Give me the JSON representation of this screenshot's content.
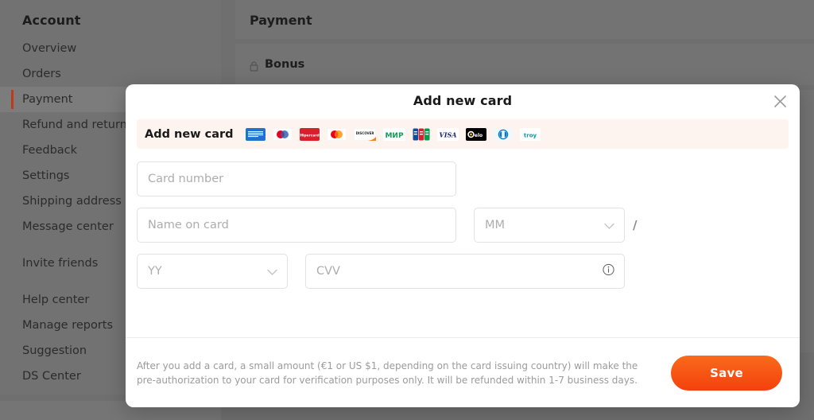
{
  "page": {
    "sidebar": {
      "title": "Account",
      "groups": [
        {
          "items": [
            {
              "label": "Overview",
              "active": false
            },
            {
              "label": "Orders",
              "active": false
            },
            {
              "label": "Payment",
              "active": true
            },
            {
              "label": "Refund and return",
              "active": false
            },
            {
              "label": "Feedback",
              "active": false
            },
            {
              "label": "Settings",
              "active": false
            },
            {
              "label": "Shipping address",
              "active": false
            },
            {
              "label": "Message center",
              "active": false
            }
          ]
        },
        {
          "items": [
            {
              "label": "Invite friends",
              "active": false
            }
          ]
        },
        {
          "items": [
            {
              "label": "Help center",
              "active": false
            },
            {
              "label": "Manage reports",
              "active": false
            },
            {
              "label": "Suggestion",
              "active": false
            },
            {
              "label": "DS Center",
              "active": false
            }
          ]
        }
      ]
    },
    "content": {
      "title": "Payment",
      "bonus_label": "Bonus",
      "bonus_icon": "lock-icon"
    }
  },
  "modal": {
    "title": "Add new card",
    "close_icon": "close-icon",
    "brand_strip": {
      "label": "Add new card",
      "brands": [
        {
          "name": "american-express",
          "text": "AMERICAN EXPRESS"
        },
        {
          "name": "maestro",
          "text": "maestro"
        },
        {
          "name": "hipercard",
          "text": "Hipercard"
        },
        {
          "name": "mastercard",
          "text": "mastercard"
        },
        {
          "name": "discover",
          "text": "DISCOVER"
        },
        {
          "name": "mir",
          "text": "МИР"
        },
        {
          "name": "jcb",
          "text": "JCB"
        },
        {
          "name": "visa",
          "text": "VISA"
        },
        {
          "name": "elo",
          "text": "elo"
        },
        {
          "name": "diners-club",
          "text": "Diners Club"
        },
        {
          "name": "troy",
          "text": "troy"
        }
      ]
    },
    "fields": {
      "card_number": {
        "placeholder": "Card number",
        "value": ""
      },
      "name_on_card": {
        "placeholder": "Name on card",
        "value": ""
      },
      "expiry_month": {
        "placeholder": "MM",
        "value": ""
      },
      "expiry_separator": "/",
      "expiry_year": {
        "placeholder": "YY",
        "value": ""
      },
      "cvv": {
        "placeholder": "CVV",
        "value": "",
        "info_icon": "info-icon"
      }
    },
    "footer": {
      "note": "After you add a card, a small amount (€1 or US $1, depending on the card issuing country) will make the pre-authorization to your card for verification purposes only. It will be refunded within 1-7 business days.",
      "save_label": "Save"
    }
  },
  "colors": {
    "accent": "#f4410d",
    "active_bar": "#c0391a",
    "strip_bg": "#fdf4f0",
    "placeholder": "#adadad"
  }
}
